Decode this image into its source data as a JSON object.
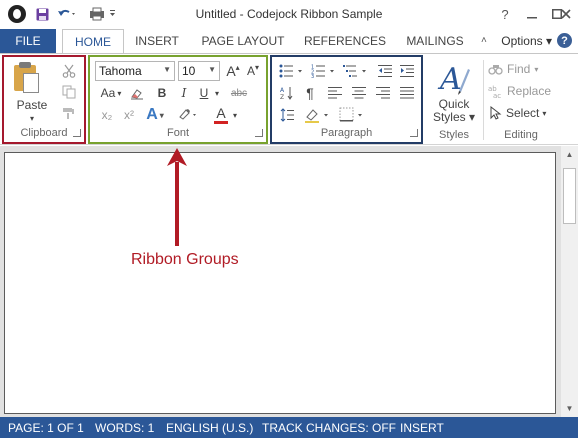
{
  "window": {
    "title": "Untitled - Codejock Ribbon Sample"
  },
  "tabs": {
    "file": "FILE",
    "items": [
      "HOME",
      "INSERT",
      "PAGE LAYOUT",
      "REFERENCES",
      "MAILINGS"
    ],
    "active": "HOME",
    "options": "Options ▾",
    "help": "?"
  },
  "ribbon": {
    "clipboard": {
      "label": "Clipboard",
      "paste": "Paste"
    },
    "font": {
      "label": "Font",
      "font_name": "Tahoma",
      "font_size": "10",
      "grow": "A",
      "shrink": "A",
      "change_case": "Aa",
      "bold": "B",
      "italic": "I",
      "underline": "U",
      "strike": "abc",
      "subscript": "x₂",
      "superscript": "x²",
      "effects": "A",
      "font_color": "A"
    },
    "paragraph": {
      "label": "Paragraph",
      "pilcrow": "¶"
    },
    "styles": {
      "label": "Styles",
      "quick_line1": "Quick",
      "quick_line2": "Styles ▾"
    },
    "editing": {
      "label": "Editing",
      "find": "Find",
      "replace": "Replace",
      "select": "Select"
    }
  },
  "annotation": {
    "text": "Ribbon Groups"
  },
  "status": {
    "page": "PAGE: 1 OF 1",
    "words": "WORDS: 1",
    "language": "ENGLISH (U.S.)",
    "track": "TRACK CHANGES: OFF",
    "mode": "INSERT"
  },
  "colors": {
    "accent": "#2b5797",
    "clipboard_outline": "#a5192e",
    "font_outline": "#78a22f",
    "paragraph_outline": "#233c66",
    "annotation": "#b11b25"
  }
}
